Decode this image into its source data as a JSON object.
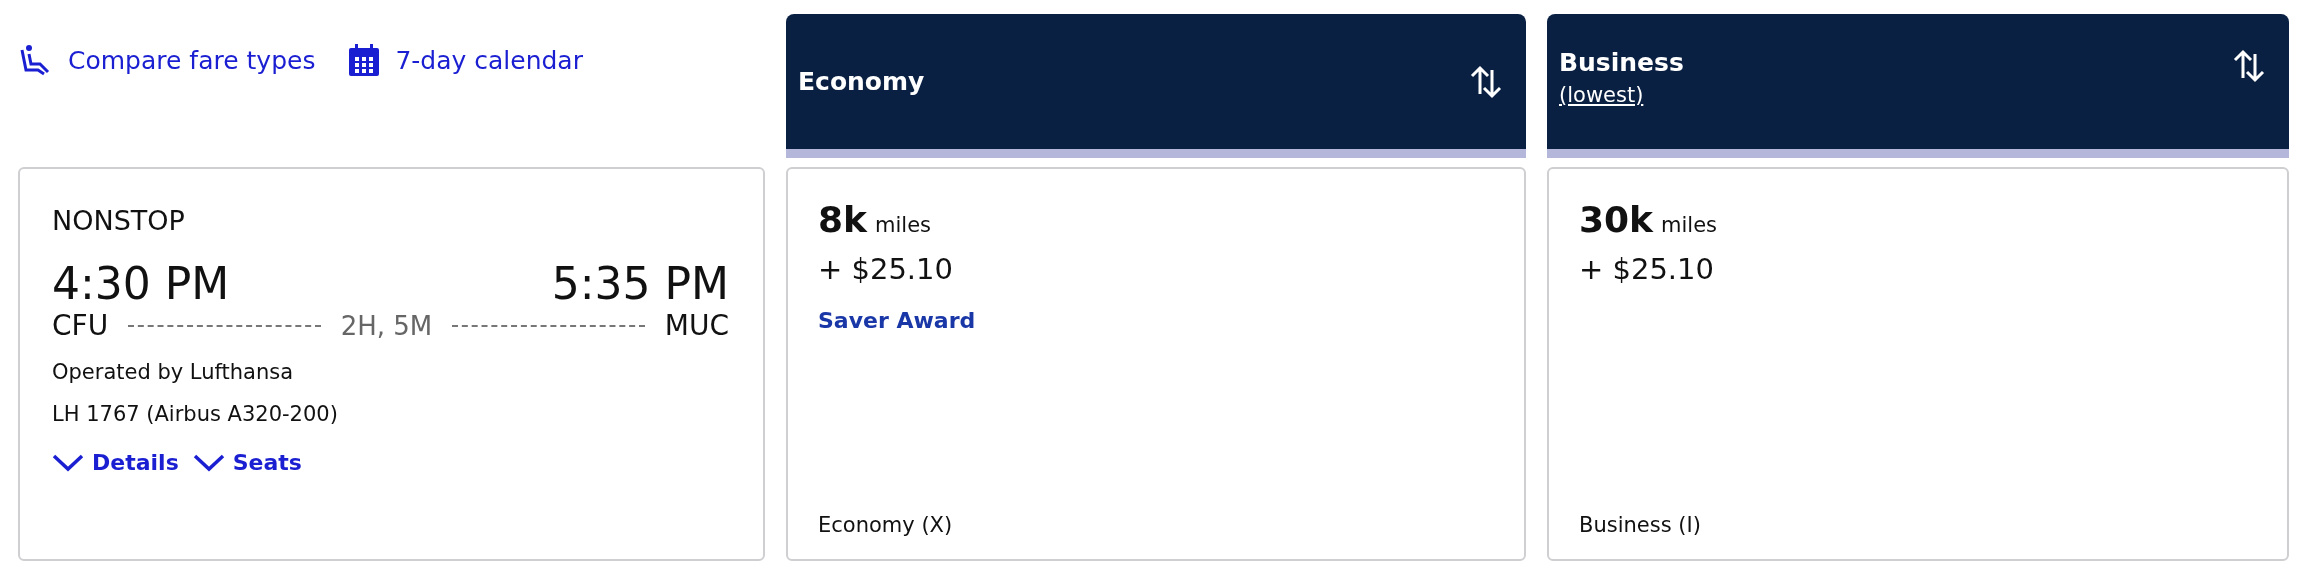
{
  "toolbar": {
    "links": [
      {
        "label": "Compare fare types",
        "kind": "seat"
      },
      {
        "label": "7-day calendar",
        "kind": "calendar"
      }
    ]
  },
  "flight": {
    "stops": "NONSTOP",
    "depart_time": "4:30 PM",
    "arrive_time": "5:35 PM",
    "origin": "CFU",
    "destination": "MUC",
    "duration": "2H, 5M",
    "operator": "Operated by Lufthansa",
    "flight_number": "LH 1767 (Airbus A320-200)",
    "links": [
      "Details",
      "Seats"
    ]
  },
  "fare_columns": [
    {
      "title": "Economy",
      "miles": "8k",
      "miles_unit": "miles",
      "price": "+ $25.10",
      "award": "Saver Award",
      "fare_class": "Economy (X)"
    },
    {
      "title": "Business",
      "subtitle": "(lowest)",
      "miles": "30k",
      "miles_unit": "miles",
      "price": "+ $25.10",
      "fare_class": "Business (I)"
    }
  ]
}
